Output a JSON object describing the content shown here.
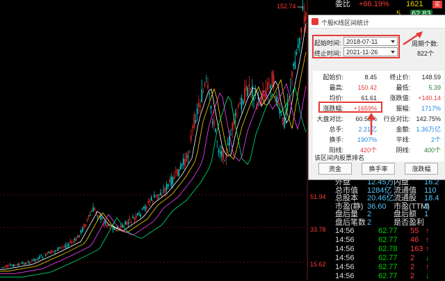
{
  "chart": {
    "peak_label": "152.74",
    "axis_labels": [
      "51.94",
      "33.78",
      "15.62"
    ]
  },
  "header": {
    "label": "委比",
    "value": "+66.19%",
    "count": "1621",
    "buy_button": "买",
    "row2_left": "5",
    "row2_value": "62.83"
  },
  "dialog": {
    "title": "个股K线区间统计",
    "start_label": "起始时间:",
    "start_value": "2018-07-11",
    "end_label": "终止时间:",
    "end_value": "2021-11-26",
    "period_label": "周期个数:",
    "period_value": "822个",
    "stats": [
      {
        "l1": "起始价:",
        "v1": "8.45",
        "l2": "终止价:",
        "v2": "148.59"
      },
      {
        "l1": "最高:",
        "v1": "150.42",
        "l2": "最低:",
        "v2": "5.39"
      },
      {
        "l1": "均价:",
        "v1": "61.61",
        "l2": "涨跌值:",
        "v2": "+140.14"
      },
      {
        "l1": "涨跌幅:",
        "v1": "+1659%",
        "l2": "振幅:",
        "v2": "1717%"
      },
      {
        "l1": "大盘对比:",
        "v1": "60.53%",
        "l2": "行业对比:",
        "v2": "142.75%"
      },
      {
        "l1": "总手:",
        "v1": "2.21亿",
        "l2": "金额:",
        "v2": "1.36万亿"
      },
      {
        "l1": "换手:",
        "v1": "1907%",
        "l2": "平线:",
        "v2": "2个"
      },
      {
        "l1": "阳线:",
        "v1": "420个",
        "l2": "阴线:",
        "v2": "400个"
      }
    ],
    "rank_label": "该区间内股票排名",
    "buttons": [
      "资金",
      "换手率",
      "涨跌幅"
    ]
  },
  "info_rows": [
    {
      "l1": "外盘",
      "v1": "12.45万",
      "l2": "内盘",
      "v2": "16.2"
    },
    {
      "l1": "总市值",
      "v1": "1284亿",
      "l2": "流通值",
      "v2": "110"
    },
    {
      "l1": "总股本",
      "v1": "20.46亿",
      "l2": "流通股",
      "v2": "18.4"
    },
    {
      "l1": "市盈(静)",
      "v1": "36.60",
      "l2": "市盈(TTM)",
      "v2": "3"
    },
    {
      "l1": "盘后量",
      "v1": "2",
      "l2": "盘后额",
      "v2": "1"
    },
    {
      "l1": "盘后笔数",
      "v1": "2",
      "l2": "是否盈利",
      "v2": ""
    }
  ],
  "ticks": [
    {
      "time": "14:56",
      "price": "62.77",
      "vol": "55",
      "dir": "up"
    },
    {
      "time": "14:56",
      "price": "62.77",
      "vol": "46",
      "dir": "up"
    },
    {
      "time": "14:56",
      "price": "62.78",
      "vol": "163",
      "dir": "up"
    },
    {
      "time": "14:56",
      "price": "62.77",
      "vol": "2",
      "dir": "down"
    },
    {
      "time": "14:56",
      "price": "62.77",
      "vol": "2",
      "dir": "up"
    },
    {
      "time": "14:56",
      "price": "62.77",
      "vol": "2",
      "dir": "down"
    }
  ]
}
